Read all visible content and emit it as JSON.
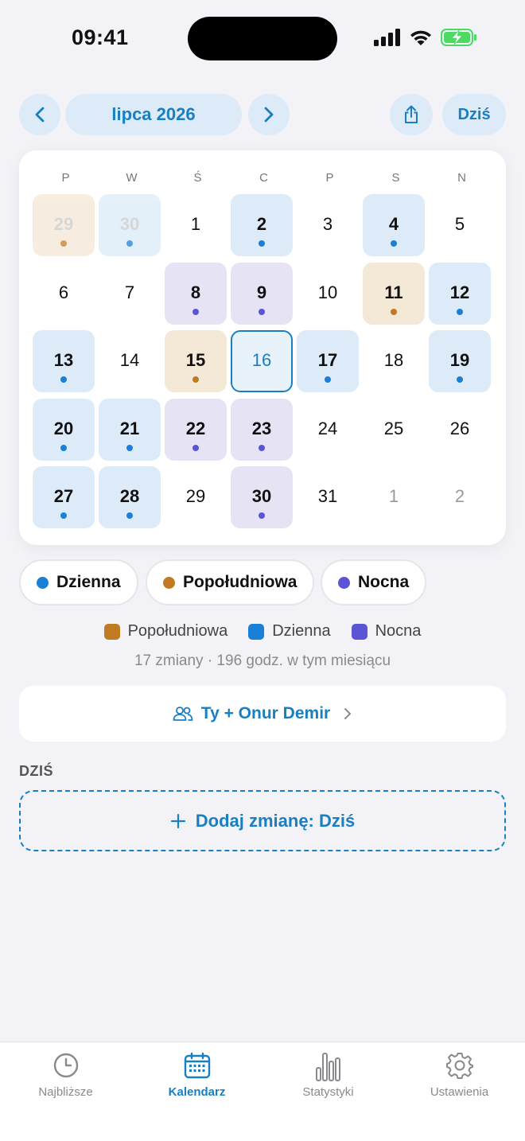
{
  "status": {
    "time": "09:41"
  },
  "header": {
    "month_label": "lipca 2026",
    "today_label": "Dziś"
  },
  "colors": {
    "accent": "#1a7fc1",
    "dzienna": "#1a7fd6",
    "popoludniowa": "#c07b22",
    "nocna": "#5b55d6",
    "dzienna_bg": "#dcebf7",
    "popoludniowa_bg": "#f4e8d6",
    "nocna_bg": "#e6e3f5"
  },
  "calendar": {
    "weekdays": [
      "P",
      "W",
      "Ś",
      "C",
      "P",
      "S",
      "N"
    ],
    "days": [
      {
        "label": "29",
        "type": "popoludniowa",
        "state": "faded"
      },
      {
        "label": "30",
        "type": "dzienna",
        "state": "faded"
      },
      {
        "label": "1",
        "type": null,
        "state": "normal"
      },
      {
        "label": "2",
        "type": "dzienna",
        "state": "normal"
      },
      {
        "label": "3",
        "type": null,
        "state": "normal"
      },
      {
        "label": "4",
        "type": "dzienna",
        "state": "normal"
      },
      {
        "label": "5",
        "type": null,
        "state": "normal"
      },
      {
        "label": "6",
        "type": null,
        "state": "normal"
      },
      {
        "label": "7",
        "type": null,
        "state": "normal"
      },
      {
        "label": "8",
        "type": "nocna",
        "state": "normal"
      },
      {
        "label": "9",
        "type": "nocna",
        "state": "normal"
      },
      {
        "label": "10",
        "type": null,
        "state": "normal"
      },
      {
        "label": "11",
        "type": "popoludniowa",
        "state": "normal"
      },
      {
        "label": "12",
        "type": "dzienna",
        "state": "normal"
      },
      {
        "label": "13",
        "type": "dzienna",
        "state": "normal"
      },
      {
        "label": "14",
        "type": null,
        "state": "normal"
      },
      {
        "label": "15",
        "type": "popoludniowa",
        "state": "normal"
      },
      {
        "label": "16",
        "type": null,
        "state": "today"
      },
      {
        "label": "17",
        "type": "dzienna",
        "state": "normal"
      },
      {
        "label": "18",
        "type": null,
        "state": "normal"
      },
      {
        "label": "19",
        "type": "dzienna",
        "state": "normal"
      },
      {
        "label": "20",
        "type": "dzienna",
        "state": "normal"
      },
      {
        "label": "21",
        "type": "dzienna",
        "state": "normal"
      },
      {
        "label": "22",
        "type": "nocna",
        "state": "normal"
      },
      {
        "label": "23",
        "type": "nocna",
        "state": "normal"
      },
      {
        "label": "24",
        "type": null,
        "state": "normal"
      },
      {
        "label": "25",
        "type": null,
        "state": "normal"
      },
      {
        "label": "26",
        "type": null,
        "state": "normal"
      },
      {
        "label": "27",
        "type": "dzienna",
        "state": "normal"
      },
      {
        "label": "28",
        "type": "dzienna",
        "state": "normal"
      },
      {
        "label": "29",
        "type": null,
        "state": "normal"
      },
      {
        "label": "30",
        "type": "nocna",
        "state": "normal"
      },
      {
        "label": "31",
        "type": null,
        "state": "normal"
      },
      {
        "label": "1",
        "type": null,
        "state": "other"
      },
      {
        "label": "2",
        "type": null,
        "state": "other"
      }
    ]
  },
  "chips": [
    {
      "label": "Dzienna",
      "type": "dzienna"
    },
    {
      "label": "Popołudniowa",
      "type": "popoludniowa"
    },
    {
      "label": "Nocna",
      "type": "nocna"
    }
  ],
  "legend": [
    {
      "label": "Popołudniowa",
      "type": "popoludniowa"
    },
    {
      "label": "Dzienna",
      "type": "dzienna"
    },
    {
      "label": "Nocna",
      "type": "nocna"
    }
  ],
  "summary": "17 zmiany · 196 godz. w tym miesiącu",
  "partner": {
    "label": "Ty + Onur Demir"
  },
  "today_section": {
    "title": "DZIŚ",
    "add_label": "Dodaj zmianę: Dziś"
  },
  "tabs": [
    {
      "label": "Najbliższe",
      "icon": "clock-icon",
      "active": false
    },
    {
      "label": "Kalendarz",
      "icon": "calendar-icon",
      "active": true
    },
    {
      "label": "Statystyki",
      "icon": "bar-chart-icon",
      "active": false
    },
    {
      "label": "Ustawienia",
      "icon": "gear-icon",
      "active": false
    }
  ]
}
